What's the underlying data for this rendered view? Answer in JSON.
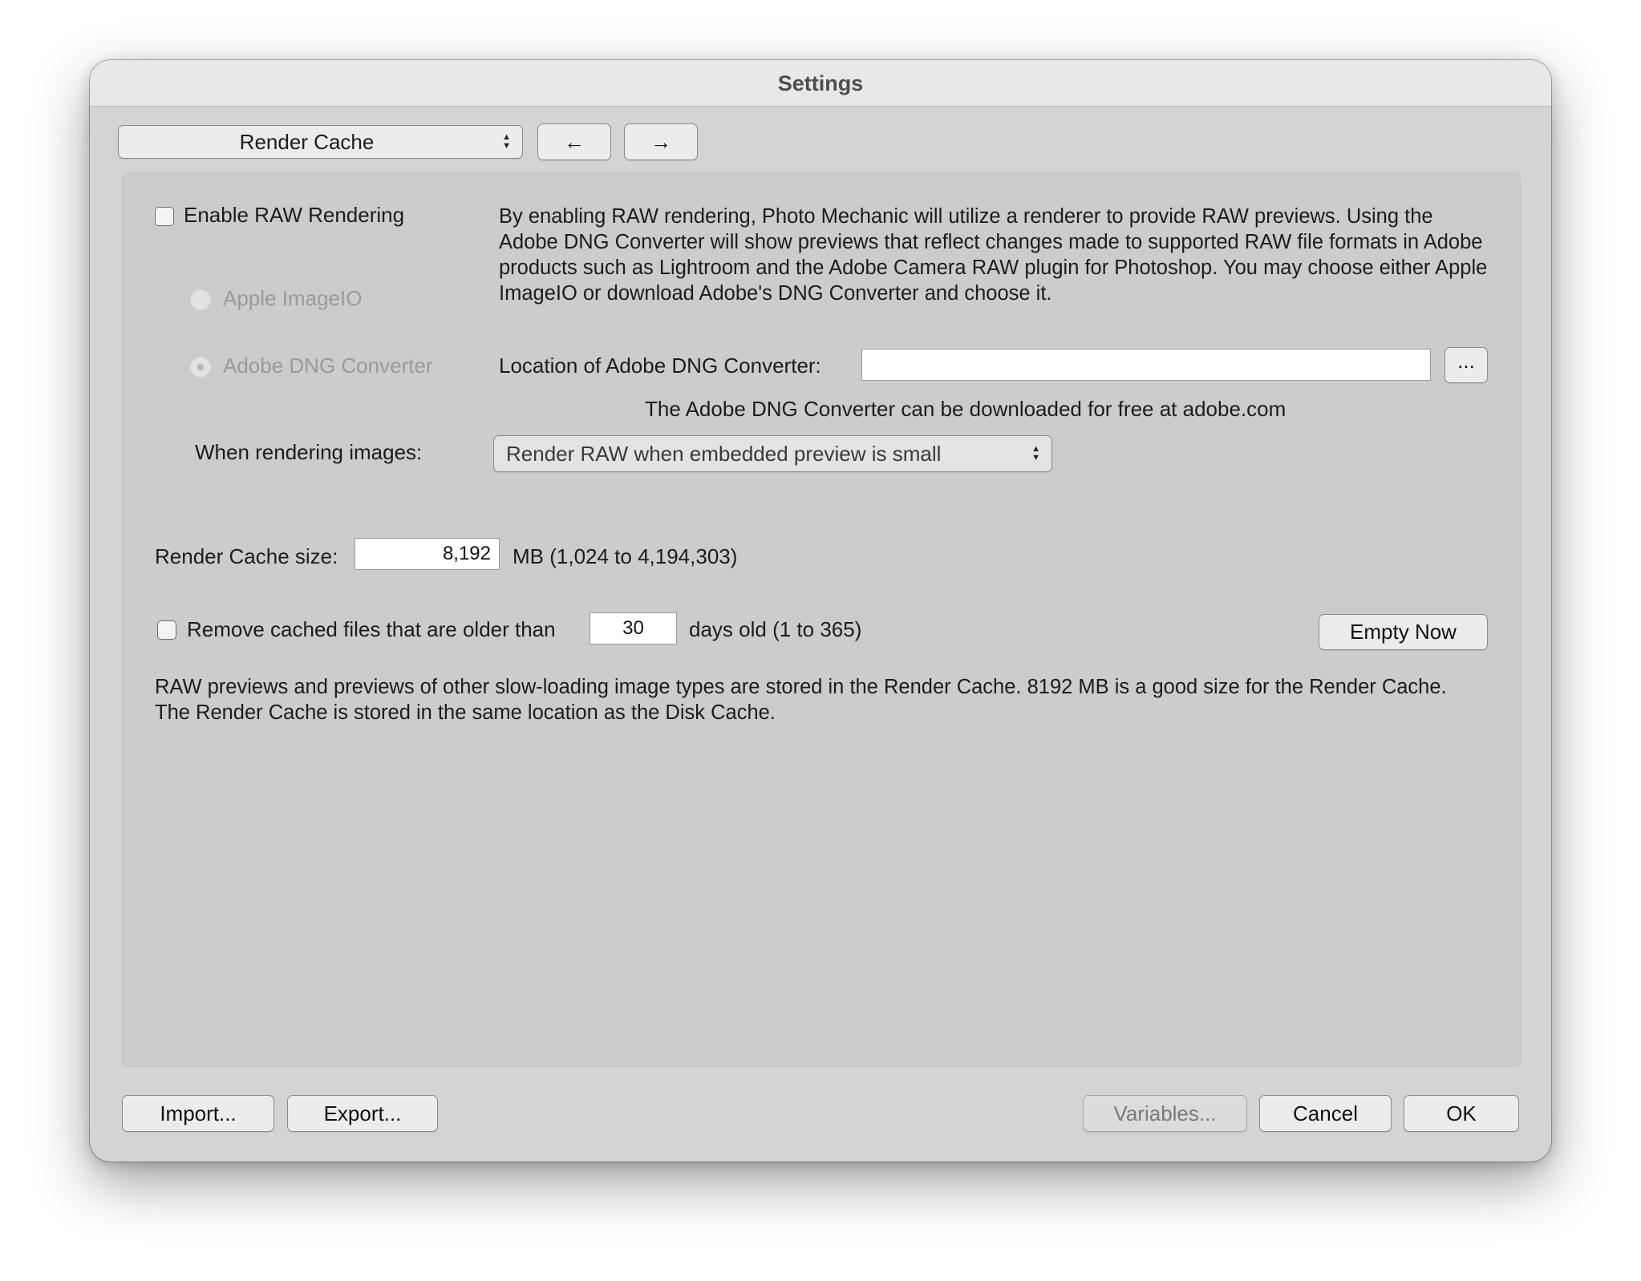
{
  "window": {
    "title": "Settings"
  },
  "toolbar": {
    "section_selected": "Render Cache",
    "back_glyph": "←",
    "forward_glyph": "→"
  },
  "raw": {
    "enable_label": "Enable RAW Rendering",
    "enable_checked": false,
    "description": "By enabling RAW rendering, Photo Mechanic will utilize a renderer to provide RAW previews.  Using the Adobe DNG Converter will show previews that reflect changes made to supported RAW file formats in Adobe products such as Lightroom and the Adobe Camera RAW plugin for Photoshop. You may choose either Apple ImageIO or download Adobe's DNG Converter and choose it.",
    "option_apple": "Apple ImageIO",
    "option_adobe": "Adobe DNG Converter",
    "location_label": "Location of Adobe DNG Converter:",
    "location_value": "",
    "browse_label": "...",
    "download_note": "The Adobe DNG Converter can be downloaded for free at adobe.com",
    "when_label": "When rendering images:",
    "when_selected": "Render RAW when embedded preview is small"
  },
  "cache": {
    "size_label": "Render Cache size:",
    "size_value": "8,192",
    "size_units": "MB (1,024 to 4,194,303)",
    "remove_label": "Remove cached files that are older than",
    "remove_checked": false,
    "days_value": "30",
    "days_units": "days old (1 to 365)",
    "empty_now_label": "Empty Now",
    "info": "RAW previews and previews of other slow-loading image types are stored in the Render Cache.  8192 MB is a good size for the Render Cache.  The Render Cache is stored in the same location as the Disk Cache."
  },
  "footer": {
    "import_label": "Import...",
    "export_label": "Export...",
    "variables_label": "Variables...",
    "cancel_label": "Cancel",
    "ok_label": "OK"
  },
  "colors": {
    "window_bg": "#d4d4d4",
    "panel_bg": "#cccccc",
    "titlebar_bg": "#e9e8e8",
    "disabled_text": "#9a9a9a"
  },
  "icons": {
    "popup_arrows": "chevron-up-down-icon",
    "back": "arrow-left-icon",
    "forward": "arrow-right-icon"
  }
}
